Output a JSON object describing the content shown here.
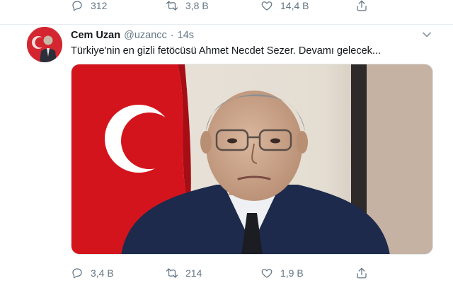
{
  "top_actions": {
    "reply_count": "312",
    "retweet_count": "3,8 B",
    "like_count": "14,4 B"
  },
  "tweet": {
    "display_name": "Cem Uzan",
    "handle": "@uzancc",
    "separator": "·",
    "time": "14s",
    "text": "Türkiye'nin en gizli fetöcüsü Ahmet Necdet Sezer. Devamı gelecek...",
    "actions": {
      "reply_count": "3,4 B",
      "retweet_count": "214",
      "like_count": "1,9 B"
    }
  },
  "icons": [
    "reply-icon",
    "retweet-icon",
    "like-icon",
    "share-icon",
    "chevron-down-icon"
  ],
  "colors": {
    "icon_gray": "#657786",
    "text": "#14171a",
    "flag_red": "#e30a17",
    "divider": "#e6ecf0"
  }
}
